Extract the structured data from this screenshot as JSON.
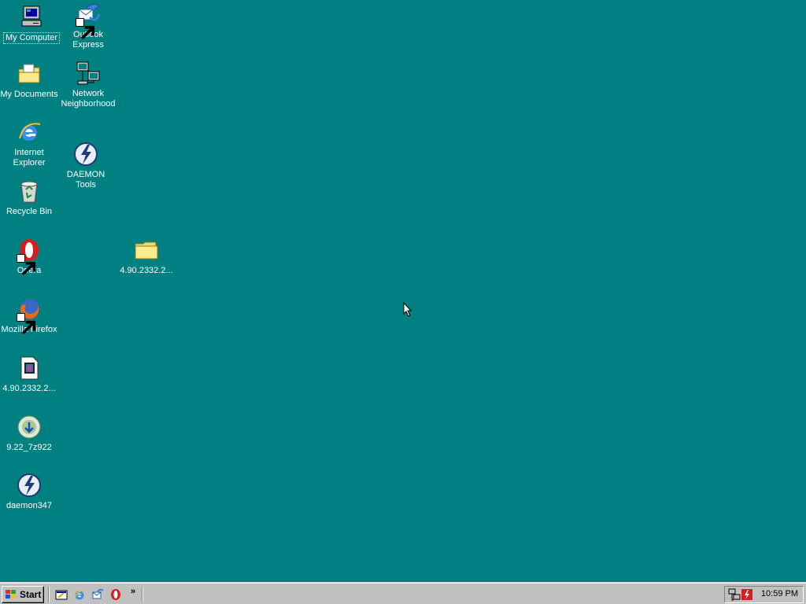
{
  "desktop": {
    "icons": [
      {
        "label": "My Computer",
        "icon": "computer-icon",
        "selected": true
      },
      {
        "label": "Outlook Express",
        "icon": "outlook-express-icon"
      },
      {
        "label": "My Documents",
        "icon": "documents-folder-icon"
      },
      {
        "label": "Network Neighborhood",
        "icon": "network-icon"
      },
      {
        "label": "Internet Explorer",
        "icon": "internet-explorer-icon"
      },
      {
        "label": "DAEMON Tools",
        "icon": "daemon-tools-icon"
      },
      {
        "label": "Recycle Bin",
        "icon": "recycle-bin-icon"
      },
      {
        "label": "Opera",
        "icon": "opera-icon"
      },
      {
        "label": "4.90.2332.2...",
        "icon": "folder-icon"
      },
      {
        "label": "Mozilla Firefox",
        "icon": "firefox-icon"
      },
      {
        "label": "4.90.2332.2...",
        "icon": "media-file-icon"
      },
      {
        "label": "9.22_7z922",
        "icon": "installer-icon"
      },
      {
        "label": "daemon347",
        "icon": "daemon-installer-icon"
      }
    ]
  },
  "taskbar": {
    "start_label": "Start",
    "quick_launch": [
      "show-desktop-icon",
      "internet-explorer-icon",
      "outlook-express-icon",
      "opera-icon"
    ],
    "overflow": "»",
    "tray": {
      "icons": [
        "network-tray-icon",
        "daemon-tray-icon"
      ],
      "clock": "10:59 PM"
    }
  },
  "colors": {
    "desktop": "#008080",
    "taskbar": "#c0c0c0"
  }
}
